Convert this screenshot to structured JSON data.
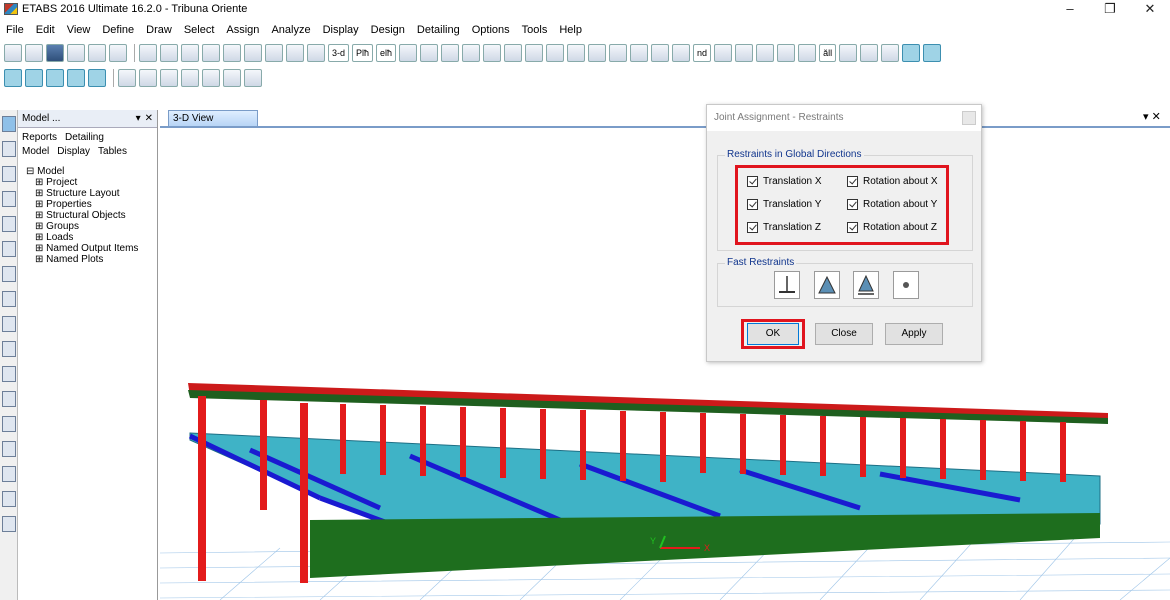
{
  "window": {
    "title": "ETABS 2016 Ultimate 16.2.0 - Tribuna Oriente",
    "minimize": "–",
    "restore": "❐",
    "close": "✕"
  },
  "menu": [
    "File",
    "Edit",
    "View",
    "Define",
    "Draw",
    "Select",
    "Assign",
    "Analyze",
    "Display",
    "Design",
    "Detailing",
    "Options",
    "Tools",
    "Help"
  ],
  "toolbar": {
    "view_3d": "3-d",
    "plan": "Plħ",
    "elev": "elħ",
    "nd": "nd",
    "all": "ăll"
  },
  "explorer": {
    "tab_label": "Model ...",
    "pin": "▾",
    "close": "✕",
    "tabs_row1": [
      "Reports",
      "Detailing"
    ],
    "tabs_row2": [
      "Model",
      "Display",
      "Tables"
    ],
    "root": "Model",
    "items": [
      "Project",
      "Structure Layout",
      "Properties",
      "Structural Objects",
      "Groups",
      "Loads",
      "Named Output Items",
      "Named Plots"
    ]
  },
  "view": {
    "tab_label": "3-D View",
    "close": "▾ ✕",
    "axis_x": "X",
    "axis_y": "Y"
  },
  "dialog": {
    "title": "Joint Assignment - Restraints",
    "group_restraints": "Restraints in Global Directions",
    "checks": [
      {
        "label": "Translation  X",
        "checked": true
      },
      {
        "label": "Rotation about  X",
        "checked": true
      },
      {
        "label": "Translation  Y",
        "checked": true
      },
      {
        "label": "Rotation about  Y",
        "checked": true
      },
      {
        "label": "Translation  Z",
        "checked": true
      },
      {
        "label": "Rotation about  Z",
        "checked": true
      }
    ],
    "group_fast": "Fast Restraints",
    "fast_buttons": [
      "fixed-support",
      "pinned-support",
      "roller-support",
      "free-support"
    ],
    "ok": "OK",
    "close": "Close",
    "apply": "Apply"
  },
  "colors": {
    "highlight": "#e0141e",
    "roof": "#cc1a1a",
    "grandstand": "#3fb3c6",
    "columns": "#e31b1b",
    "walls": "#1e6e1e",
    "beams": "#1a1ad1",
    "grid": "#6fa8dc"
  }
}
